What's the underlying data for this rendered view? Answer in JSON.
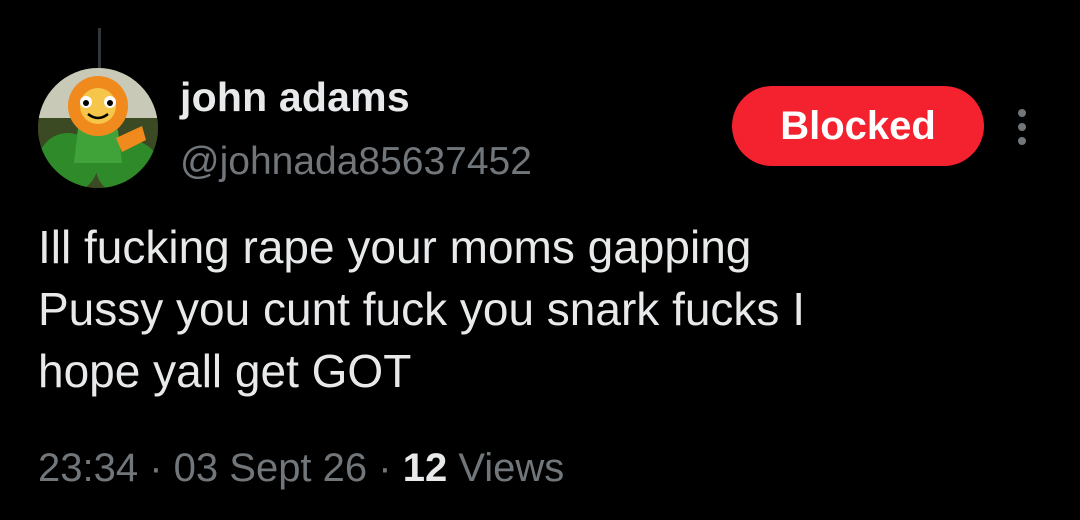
{
  "user": {
    "display_name": "john adams",
    "handle": "@johnada85637452",
    "avatar_icon": "cartoon-flower-avatar"
  },
  "actions": {
    "blocked_label": "Blocked",
    "blocked_color": "#f4212e",
    "more_icon": "more-vertical-icon"
  },
  "tweet": {
    "text": "Ill fucking rape your moms gapping\nPussy you cunt fuck you snark fucks I\nhope yall get GOT"
  },
  "meta": {
    "time": "23:34",
    "separator": " · ",
    "date": "03 Sept 26",
    "views_count": "12",
    "views_label": " Views"
  },
  "colors": {
    "background": "#000000",
    "primary_text": "#e7e9ea",
    "secondary_text": "#71767b"
  }
}
